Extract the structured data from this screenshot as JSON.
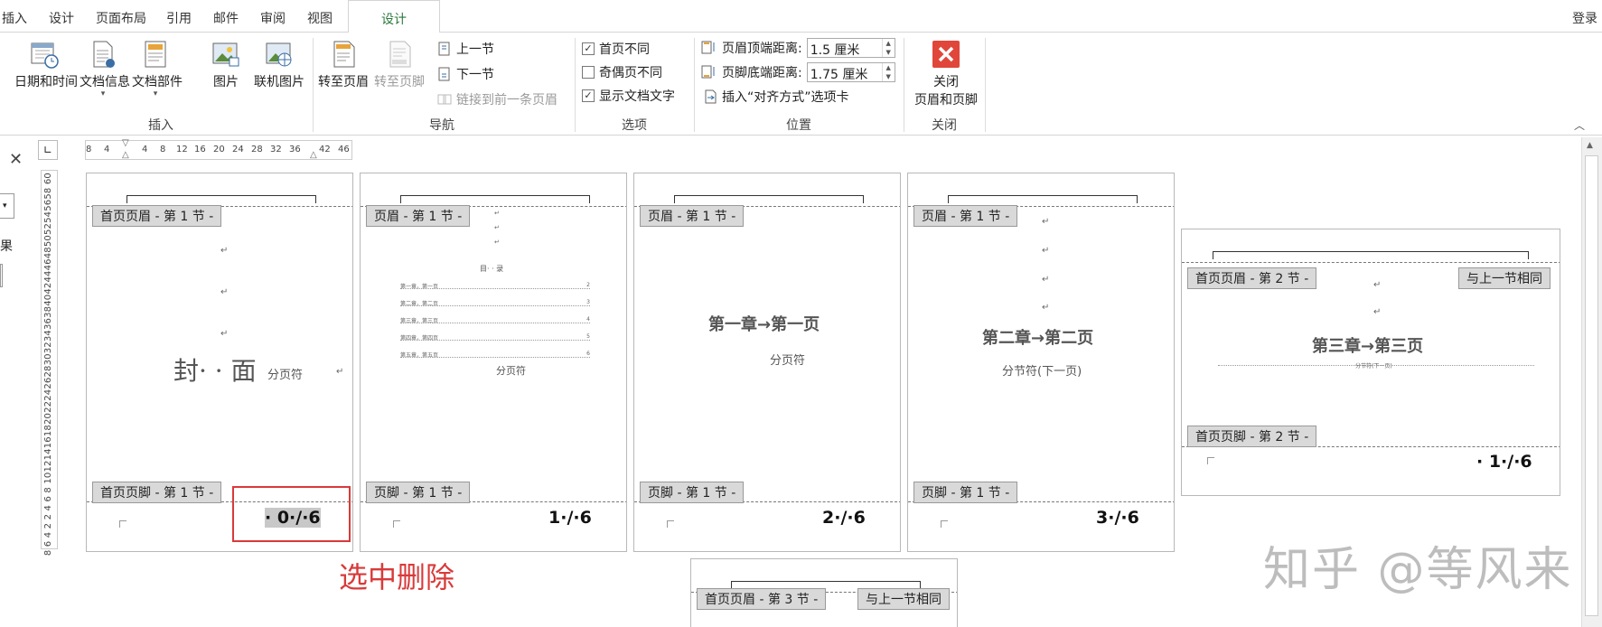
{
  "tabs": [
    "插入",
    "设计",
    "页面布局",
    "引用",
    "邮件",
    "审阅",
    "视图"
  ],
  "active_tab": "设计",
  "login": "登录",
  "groups": {
    "insert": "插入",
    "nav": "导航",
    "options": "选项",
    "position": "位置",
    "close": "关闭"
  },
  "insert_buttons": {
    "datetime": "日期和时间",
    "docinfo": "文档信息",
    "parts": "文档部件",
    "picture": "图片",
    "online": "联机图片"
  },
  "nav": {
    "goto_header": "转至页眉",
    "goto_footer": "转至页脚",
    "prev": "上一节",
    "next": "下一节",
    "link": "链接到前一条页眉"
  },
  "options": {
    "first_diff": "首页不同",
    "odd_even": "奇偶页不同",
    "show_text": "显示文档文字",
    "first_checked": "✓",
    "show_checked": "✓"
  },
  "position": {
    "header_label": "页眉顶端距离:",
    "header_val": "1.5 厘米",
    "footer_label": "页脚底端距离:",
    "footer_val": "1.75 厘米",
    "align_tab": "插入“对齐方式”选项卡"
  },
  "close": {
    "line1": "关闭",
    "line2": "页眉和页脚"
  },
  "side": {
    "close": "✕",
    "result": "果"
  },
  "ruler": {
    "nums": [
      "8",
      "4",
      "4",
      "8",
      "12",
      "16",
      "20",
      "24",
      "28",
      "32",
      "36",
      "42",
      "46"
    ],
    "vertical": "8 6 4 2   2 4 6 8 10121416182022242628303234363840424446485052545658 60"
  },
  "pages": [
    {
      "header_label": "首页页眉 - 第 1 节 -",
      "footer_label": "首页页脚 - 第 1 节 -",
      "title": "封· · 面",
      "break": "分页符",
      "page_num": "· 0·/·6"
    },
    {
      "header_label": "页眉 - 第 1 节 -",
      "footer_label": "页脚 - 第 1 节 -",
      "toc_title": "目· · 录",
      "toc": [
        "第一章，第一页",
        "第二章，第二页",
        "第三章，第三页",
        "第四章，第四页",
        "第五章，第五页"
      ],
      "toc_pages": [
        "2",
        "3",
        "4",
        "5",
        "6"
      ],
      "break": "分页符",
      "page_num": "1·/·6"
    },
    {
      "header_label": "页眉 - 第 1 节 -",
      "footer_label": "页脚 - 第 1 节 -",
      "title": "第一章→第一页",
      "break": "分页符",
      "page_num": "2·/·6"
    },
    {
      "header_label": "页眉 - 第 1 节 -",
      "footer_label": "页脚 - 第 1 节 -",
      "title": "第二章→第二页",
      "break": "分节符(下一页)",
      "page_num": "3·/·6"
    },
    {
      "header_label": "首页页眉 - 第 2 节 -",
      "same": "与上一节相同",
      "footer_label": "首页页脚 - 第 2 节 -",
      "title": "第三章→第三页",
      "break": "分节符(下一页)",
      "page_num": "· 1·/·6"
    },
    {
      "header_label": "首页页眉 - 第 3 节 -",
      "same": "与上一节相同"
    }
  ],
  "annotation": "选中删除",
  "watermark": "知乎 @等风来",
  "colors": {
    "accent": "#2b7a3b",
    "annotation": "#d93a3a",
    "close_btn": "#e0473a"
  }
}
